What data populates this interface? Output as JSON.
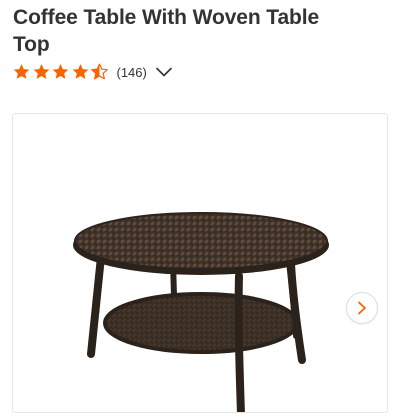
{
  "product": {
    "title": "Coffee Table With Woven Table Top",
    "rating": {
      "value": 4.5,
      "max": 5,
      "count_label": "(146)"
    }
  },
  "gallery": {
    "image_alt": "Coffee Table With Woven Table Top",
    "next_label": "Next image"
  },
  "colors": {
    "star_fill": "#f96302",
    "chevron_accent": "#f96302",
    "table_frame": "#2c221c",
    "wicker": "#4a3b30"
  },
  "icons": {
    "star": "star-icon",
    "half_star": "half-star-icon",
    "expand": "chevron-down-icon",
    "next": "chevron-right-icon"
  }
}
